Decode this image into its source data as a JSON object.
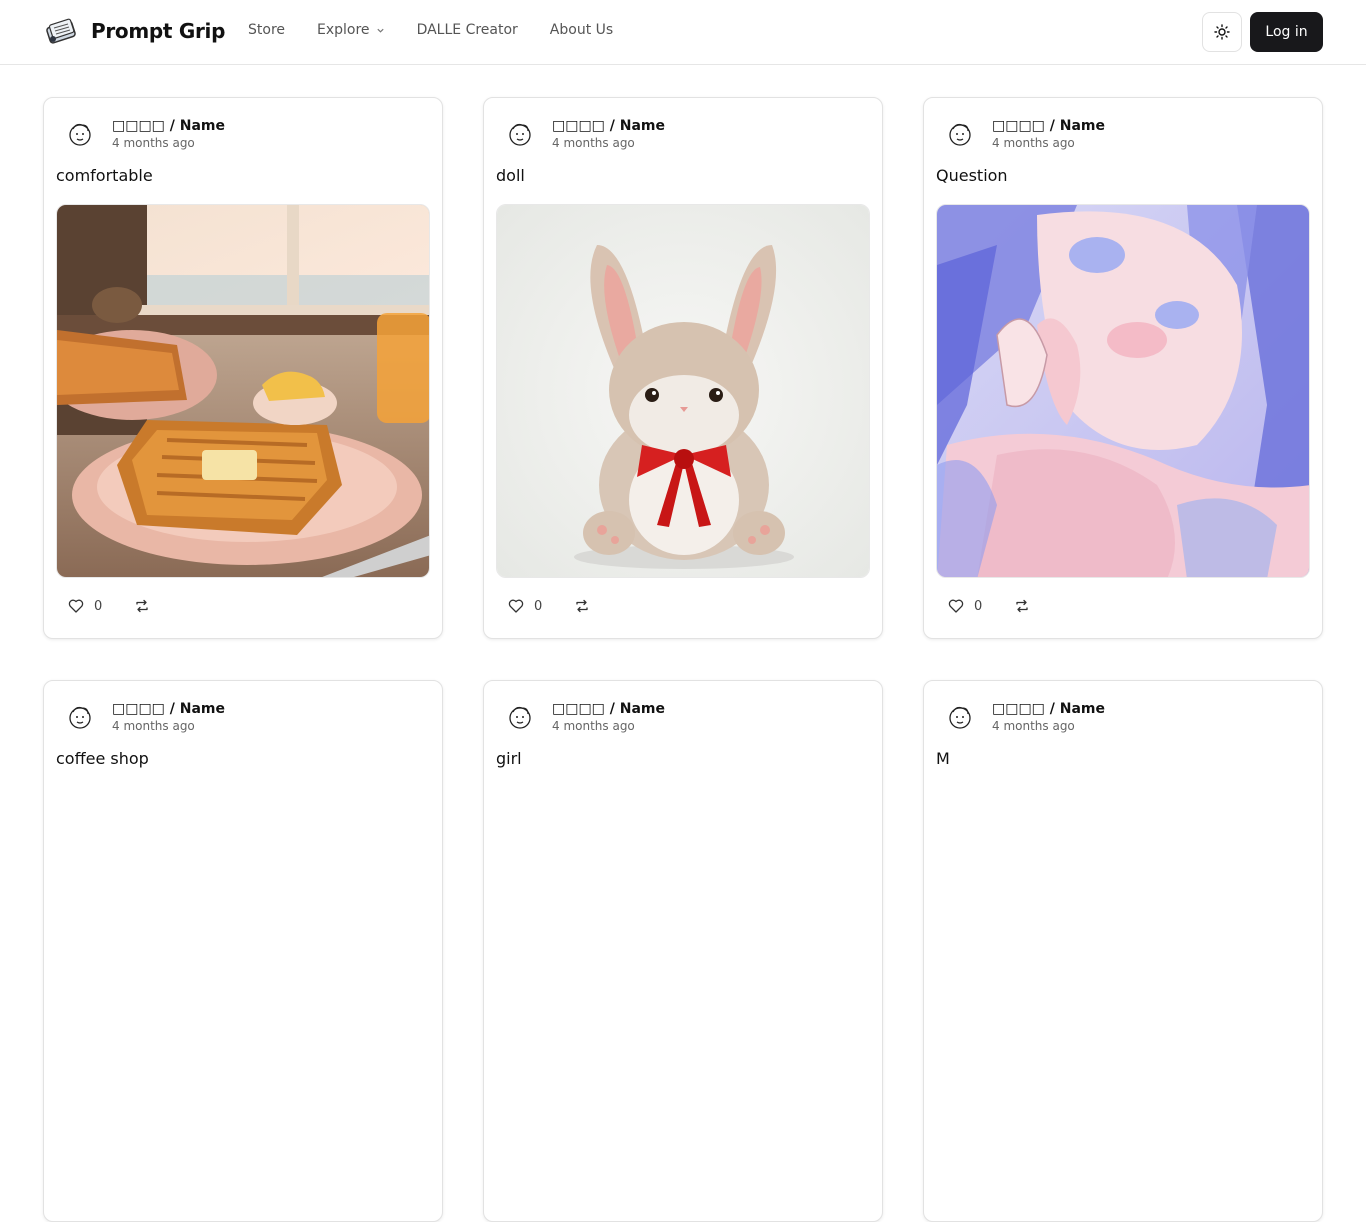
{
  "header": {
    "brand": "Prompt Grip",
    "nav": [
      "Store",
      "Explore",
      "DALLE Creator",
      "About Us"
    ],
    "login": "Log in"
  },
  "cards": [
    {
      "author": "□□□□ / Name",
      "time": "4 months ago",
      "title": "comfortable",
      "likes": "0",
      "image": "toast-breakfast"
    },
    {
      "author": "□□□□ / Name",
      "time": "4 months ago",
      "title": "doll",
      "likes": "0",
      "image": "plush-bunny"
    },
    {
      "author": "□□□□ / Name",
      "time": "4 months ago",
      "title": "Question",
      "likes": "0",
      "image": "anime-girl"
    },
    {
      "author": "□□□□ / Name",
      "time": "4 months ago",
      "title": "coffee shop",
      "likes": "",
      "image": ""
    },
    {
      "author": "□□□□ / Name",
      "time": "4 months ago",
      "title": "girl",
      "likes": "",
      "image": ""
    },
    {
      "author": "□□□□ / Name",
      "time": "4 months ago",
      "title": "M",
      "likes": "",
      "image": ""
    }
  ],
  "colors": {
    "accent": "#18181b",
    "border": "#e2e2e2",
    "muted": "#666666"
  }
}
